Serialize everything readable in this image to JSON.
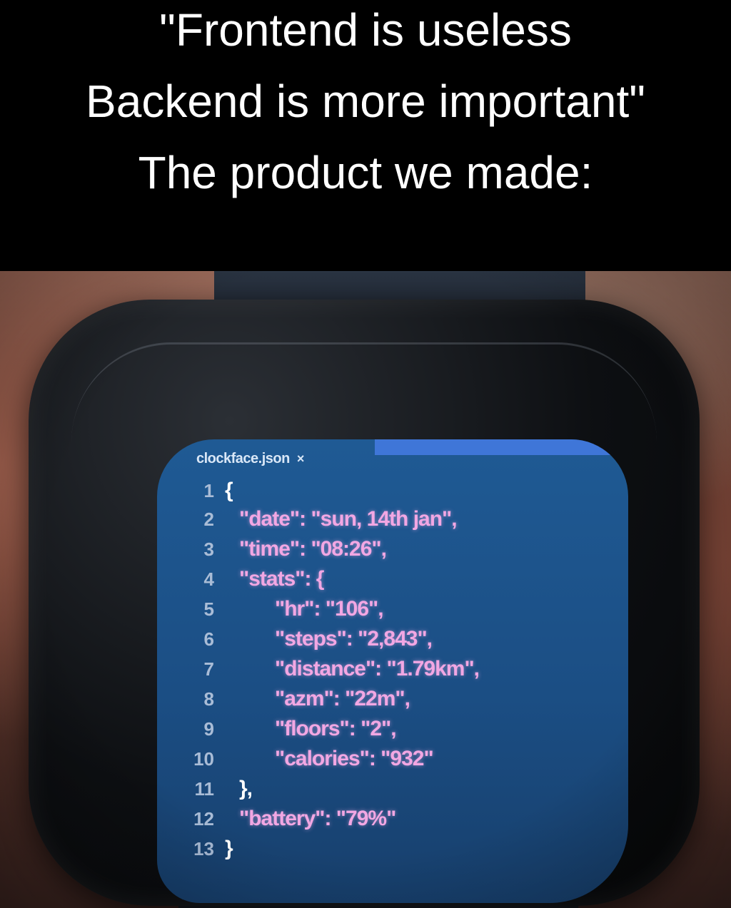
{
  "caption": {
    "line1": "\"Frontend is useless",
    "line2": "Backend is more important\"",
    "line3": "The product we made:"
  },
  "editor": {
    "tab_label": "clockface.json",
    "tab_close": "×",
    "lines": [
      {
        "n": "1",
        "text": "{"
      },
      {
        "n": "2",
        "text": "\"date\": \"sun, 14th jan\","
      },
      {
        "n": "3",
        "text": "\"time\": \"08:26\","
      },
      {
        "n": "4",
        "text": "\"stats\": {"
      },
      {
        "n": "5",
        "text": "\"hr\": \"106\","
      },
      {
        "n": "6",
        "text": "\"steps\": \"2,843\","
      },
      {
        "n": "7",
        "text": "\"distance\": \"1.79km\","
      },
      {
        "n": "8",
        "text": "\"azm\": \"22m\","
      },
      {
        "n": "9",
        "text": "\"floors\": \"2\","
      },
      {
        "n": "10",
        "text": "\"calories\": \"932\""
      },
      {
        "n": "11",
        "text": "},"
      },
      {
        "n": "12",
        "text": "\"battery\": \"79%\""
      },
      {
        "n": "13",
        "text": "}"
      }
    ]
  },
  "colors": {
    "screen_bg": "#1f5a94",
    "key_text": "#f2a7e3",
    "tab_highlight": "#3f76d8"
  }
}
